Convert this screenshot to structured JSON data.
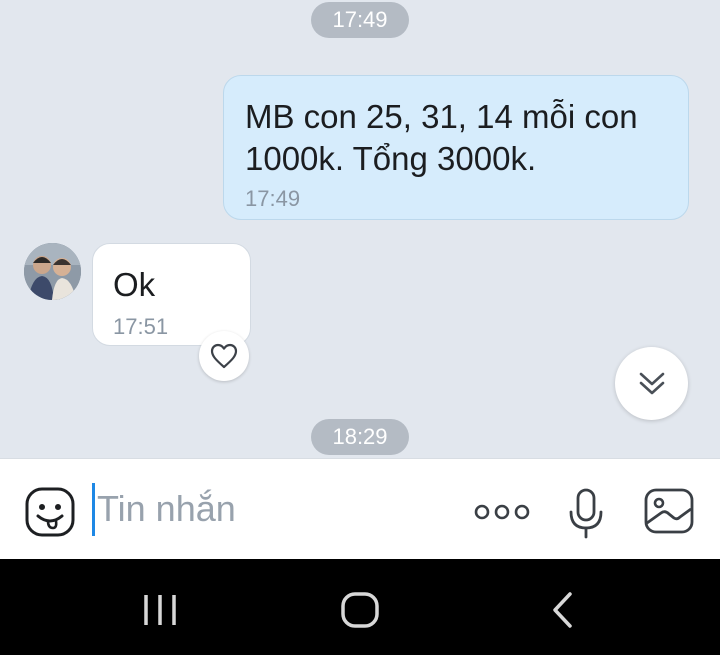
{
  "chat": {
    "time_separators": [
      "17:49",
      "18:29"
    ],
    "outgoing_message": {
      "text": "MB con 25, 31, 14 mỗi con 1000k. Tổng 3000k.",
      "time": "17:49"
    },
    "incoming_message": {
      "text": "Ok",
      "time": "17:51"
    },
    "icons": {
      "reaction": "heart-icon",
      "scroll": "double-chevron-down-icon"
    }
  },
  "composer": {
    "placeholder": "Tin nhắn",
    "value": "",
    "icons": [
      "sticker-icon",
      "more-dots-icon",
      "microphone-icon",
      "image-icon"
    ]
  },
  "navbar": {
    "icons": [
      "recent-apps-icon",
      "home-icon",
      "back-icon"
    ]
  },
  "colors": {
    "chat_background": "#e2e7ee",
    "outgoing_bubble": "#d6ecfc",
    "incoming_bubble": "#ffffff",
    "time_pill": "#b4bbc4",
    "caret": "#1e88e5"
  }
}
